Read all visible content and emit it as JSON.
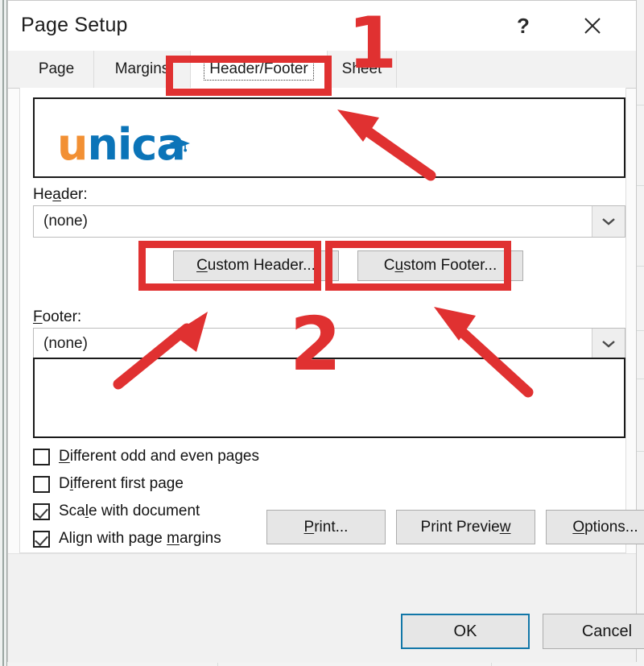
{
  "window": {
    "title": "Page Setup",
    "help_icon": "question-mark-icon",
    "help_label": "?",
    "close_icon": "close-x-icon"
  },
  "tabs": [
    {
      "label": "Page",
      "active": false
    },
    {
      "label": "Margins",
      "active": false
    },
    {
      "label": "Header/Footer",
      "active": true
    },
    {
      "label": "Sheet",
      "active": false
    }
  ],
  "brand": {
    "text_u": "u",
    "text_rest": "nica",
    "orange": "#f29034",
    "blue": "#0b74b8",
    "cap_icon": "graduation-cap-icon"
  },
  "header_section": {
    "label_pre": "He",
    "label_accel": "a",
    "label_post": "der:",
    "value": "(none)",
    "dropdown_icon": "chevron-down-icon"
  },
  "footer_section": {
    "label_pre": "",
    "label_accel": "F",
    "label_post": "ooter:",
    "value": "(none)",
    "dropdown_icon": "chevron-down-icon"
  },
  "custom_buttons": {
    "header_pre": "",
    "header_accel": "C",
    "header_post": "ustom Header...",
    "footer_pre": "C",
    "footer_accel": "u",
    "footer_post": "stom Footer..."
  },
  "checkboxes": [
    {
      "pre": "",
      "accel": "D",
      "post": "ifferent odd and even pages",
      "checked": false
    },
    {
      "pre": "D",
      "accel": "i",
      "post": "fferent first page",
      "checked": false
    },
    {
      "pre": "Sca",
      "accel": "l",
      "post": "e with document",
      "checked": true
    },
    {
      "pre": "Align with page ",
      "accel": "m",
      "post": "argins",
      "checked": true
    }
  ],
  "action_buttons": {
    "print_pre": "",
    "print_accel": "P",
    "print_post": "rint...",
    "preview_pre": "Print Previe",
    "preview_accel": "w",
    "preview_post": "",
    "options_pre": "",
    "options_accel": "O",
    "options_post": "ptions..."
  },
  "footer_bar": {
    "ok_label": "OK",
    "cancel_label": "Cancel",
    "ok_focus_color": "#1277a8"
  },
  "annotations": {
    "color": "#e03131",
    "step_one": "1",
    "step_two": "2",
    "boxes": [
      "header-footer-tab",
      "custom-header-button",
      "custom-footer-button"
    ],
    "arrows": [
      "arrow-to-tab",
      "arrow-to-custom-header",
      "arrow-to-custom-footer"
    ]
  }
}
